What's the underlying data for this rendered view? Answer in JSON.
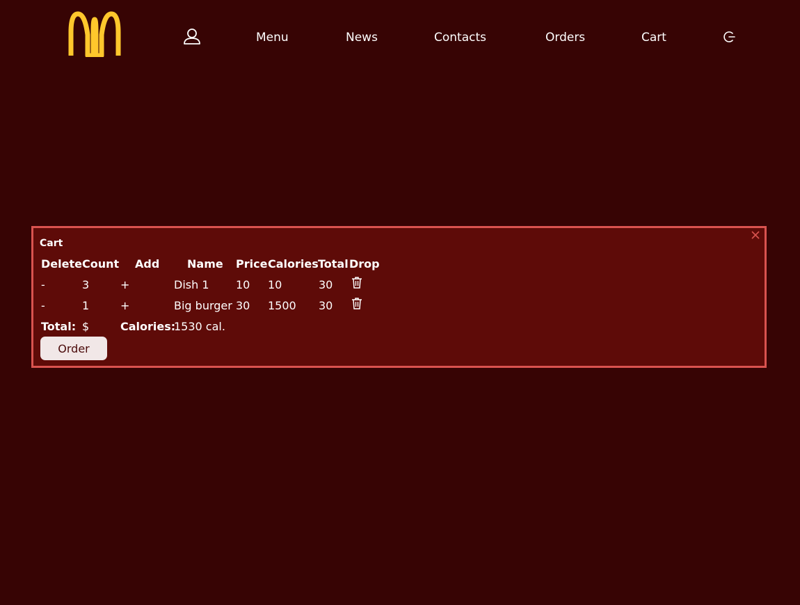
{
  "nav": {
    "logo_icon": "mcdonalds-arches-logo",
    "profile_icon": "user-icon",
    "menu": "Menu",
    "news": "News",
    "contacts": "Contacts",
    "orders": "Orders",
    "cart": "Cart",
    "logout_icon": "logout-icon"
  },
  "cart": {
    "title": "Cart",
    "close_icon": "close-icon",
    "columns": [
      "Delete",
      "Count",
      "Add",
      "Name",
      "Price",
      "Calories",
      "Total",
      "Drop"
    ],
    "rows": [
      {
        "delete": "-",
        "count": "3",
        "add": "+",
        "name": "Dish 1",
        "price": "10",
        "calories": "10",
        "total": "30",
        "drop_icon": "trash-icon"
      },
      {
        "delete": "-",
        "count": "1",
        "add": "+",
        "name": "Big burger",
        "price": "30",
        "calories": "1500",
        "total": "30",
        "drop_icon": "trash-icon"
      }
    ],
    "total_label": "Total:",
    "total_value": "$",
    "calories_label": "Calories:",
    "calories_value": "1530 cal.",
    "order_button": "Order"
  },
  "colors": {
    "background": "#370404",
    "panel": "#5e0b08",
    "panel_border": "#d9534f",
    "logo": "#ffc72c"
  }
}
